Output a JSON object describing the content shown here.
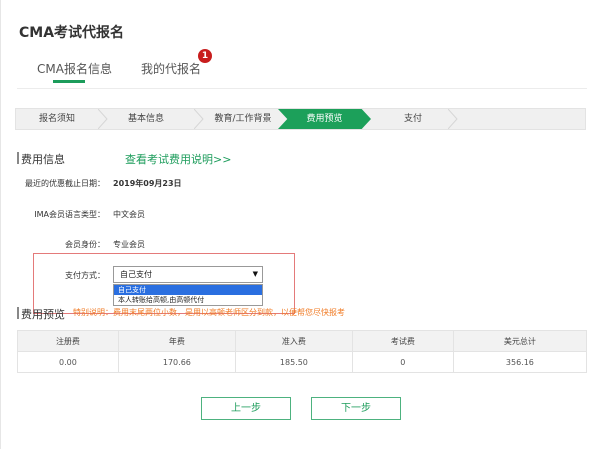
{
  "page": {
    "title": "CMA考试代报名"
  },
  "tabs": [
    {
      "label": "CMA报名信息",
      "active": true
    },
    {
      "label": "我的代报名",
      "badge": "1"
    }
  ],
  "steps": [
    "报名须知",
    "基本信息",
    "教育/工作背景",
    "费用预览",
    "支付"
  ],
  "active_step": "费用预览",
  "fee_info": {
    "section_title": "费用信息",
    "link": "查看考试费用说明>>",
    "fields": [
      {
        "label": "最近的优惠截止日期：",
        "value": "2019年09月23日"
      },
      {
        "label": "IMA会员语言类型：",
        "value": "中文会员"
      },
      {
        "label": "会员身份：",
        "value": "专业会员"
      },
      {
        "label": "支付方式："
      }
    ],
    "payment": {
      "selected": "自己支付",
      "options": [
        "自己支付",
        "本人转账给高顿,由高顿代付"
      ]
    }
  },
  "preview": {
    "section_title": "费用预览",
    "note": "特别说明：费用末尾两位小数，是用以高顿老师区分到款，以便帮您尽快报考",
    "headers": [
      "注册费",
      "年费",
      "准入费",
      "考试费",
      "美元总计"
    ],
    "values": [
      "0.00",
      "170.66",
      "185.50",
      "0",
      "356.16"
    ]
  },
  "buttons": {
    "prev": "上一步",
    "next": "下一步"
  },
  "colors": {
    "accent": "#1c9c5b",
    "badge": "#c81d1d",
    "note": "#f07b25",
    "highlight_box": "#e47a7a"
  }
}
